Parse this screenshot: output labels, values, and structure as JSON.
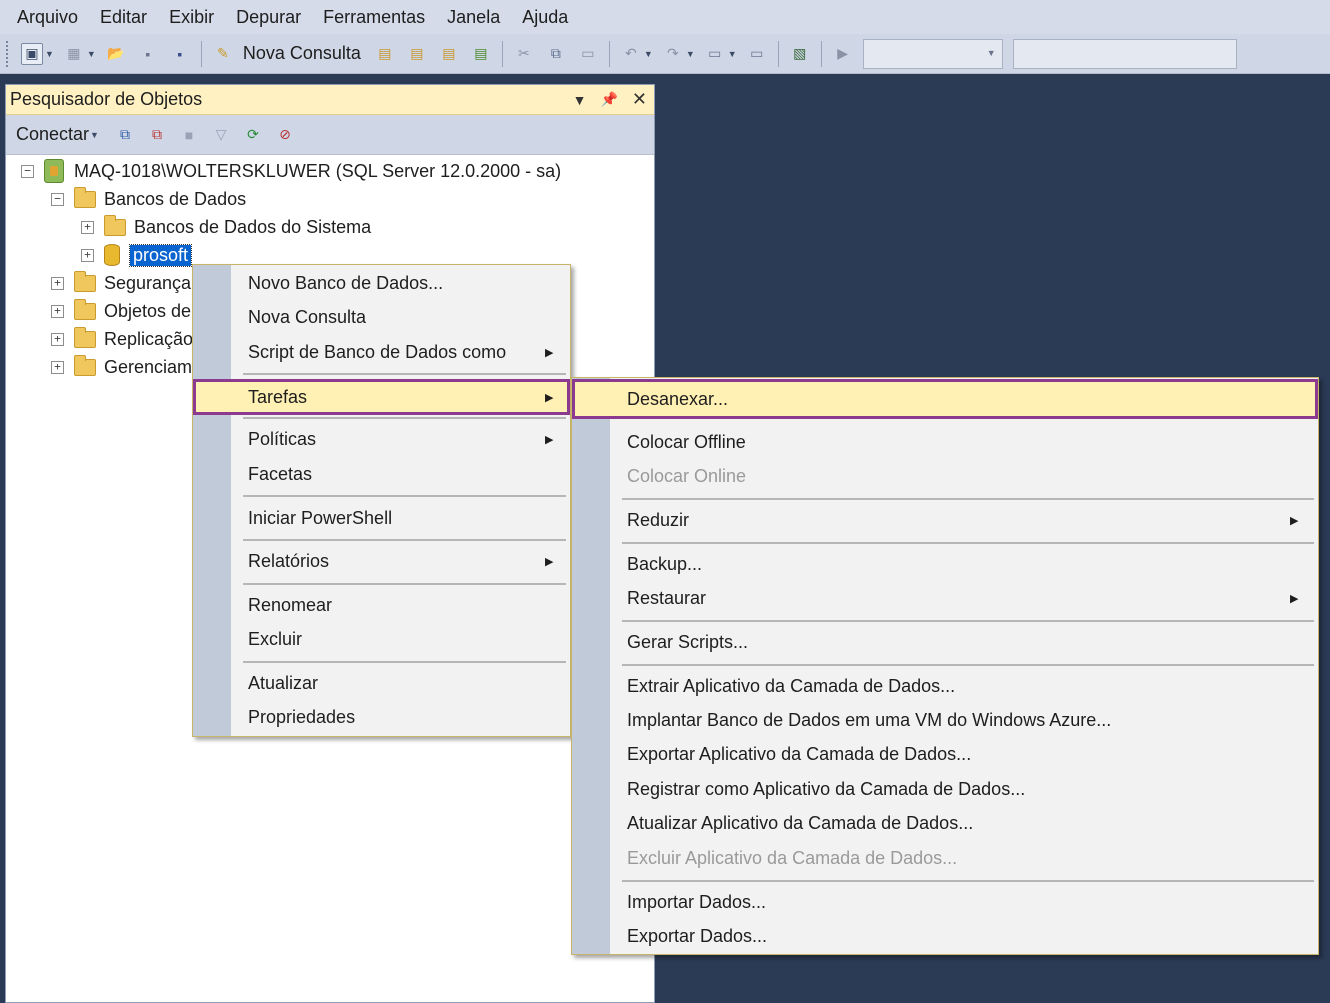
{
  "menubar": [
    "Arquivo",
    "Editar",
    "Exibir",
    "Depurar",
    "Ferramentas",
    "Janela",
    "Ajuda"
  ],
  "toolbar": {
    "new_query_label": "Nova Consulta"
  },
  "explorer": {
    "title": "Pesquisador de Objetos",
    "connect_label": "Conectar",
    "server": "MAQ-1018\\WOLTERSKLUWER (SQL Server 12.0.2000 - sa)",
    "databases": "Bancos de Dados",
    "system_dbs": "Bancos de Dados do Sistema",
    "selected_db": "prosoft",
    "truncated": [
      "Segurança",
      "Objetos de",
      "Replicação",
      "Gerenciam"
    ]
  },
  "context_menu": {
    "new_db": "Novo Banco de Dados...",
    "new_query": "Nova Consulta",
    "script_db": "Script de Banco de Dados como",
    "tasks": "Tarefas",
    "policies": "Políticas",
    "facets": "Facetas",
    "powershell": "Iniciar PowerShell",
    "reports": "Relatórios",
    "rename": "Renomear",
    "delete": "Excluir",
    "refresh": "Atualizar",
    "properties": "Propriedades"
  },
  "tasks_menu": {
    "detach": "Desanexar...",
    "offline": "Colocar Offline",
    "online": "Colocar Online",
    "shrink": "Reduzir",
    "backup": "Backup...",
    "restore": "Restaurar",
    "gen_scripts": "Gerar Scripts...",
    "extract_dac": "Extrair Aplicativo da Camada de Dados...",
    "deploy_azure": "Implantar Banco de Dados em uma VM do Windows Azure...",
    "export_dac": "Exportar Aplicativo da Camada de Dados...",
    "register_dac": "Registrar como Aplicativo da Camada de Dados...",
    "upgrade_dac": "Atualizar Aplicativo da Camada de Dados...",
    "delete_dac": "Excluir Aplicativo da Camada de Dados...",
    "import_data": "Importar Dados...",
    "export_data": "Exportar Dados..."
  },
  "colors": {
    "highlight_border": "#8b3a8f",
    "highlight_fill": "#fff0b3",
    "background": "#2b3a55"
  }
}
